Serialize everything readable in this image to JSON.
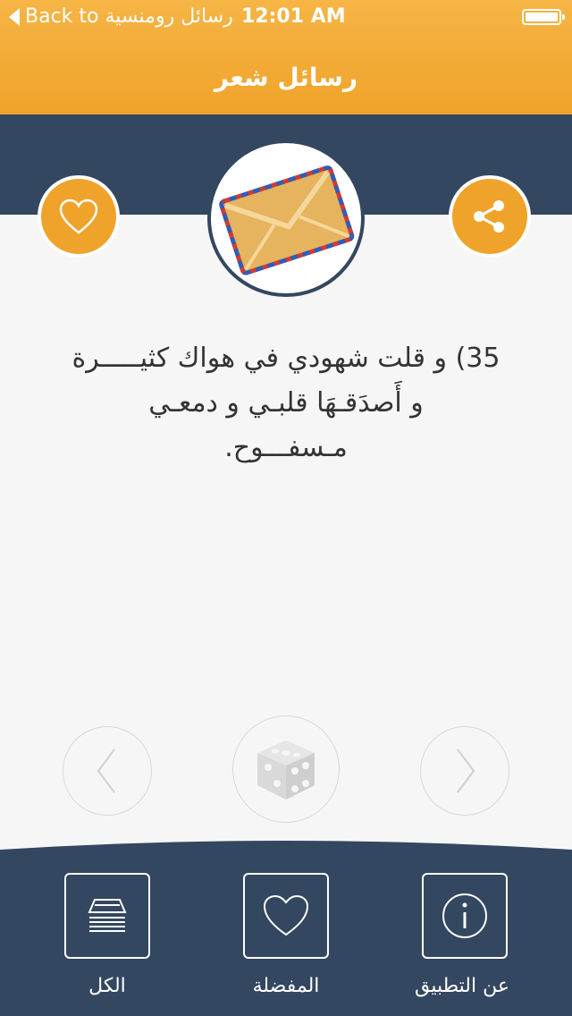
{
  "status_bar": {
    "back_label": "Back to رسائل رومنسية",
    "time": "12:01 AM"
  },
  "nav": {
    "title": "رسائل شعر"
  },
  "message": {
    "line1": "35) و قلت شهودي في هواك كثيـــــرة",
    "line2": "و أَصدَقـهَا قلبـي و دمعـي",
    "line3": "مـسفـــوح."
  },
  "tabs": [
    {
      "label": "الكل",
      "icon": "list-icon"
    },
    {
      "label": "المفضلة",
      "icon": "heart-icon"
    },
    {
      "label": "عن التطبيق",
      "icon": "info-icon"
    }
  ],
  "colors": {
    "accent": "#f0a32a",
    "navy": "#344760",
    "background": "#f6f6f6"
  }
}
